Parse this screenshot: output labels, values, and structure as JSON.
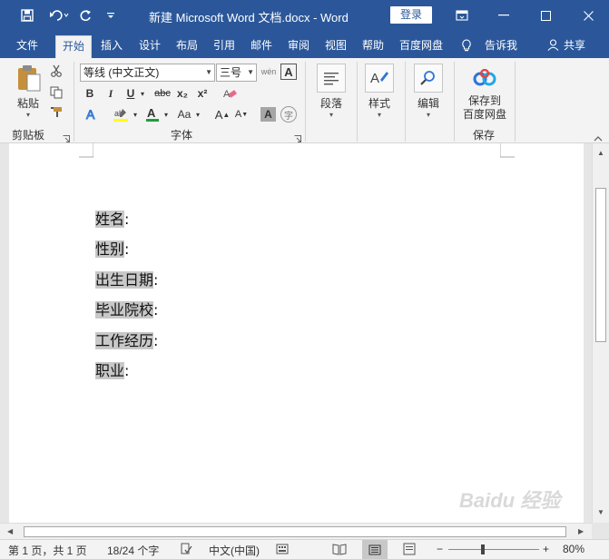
{
  "window": {
    "title": "新建 Microsoft Word 文档.docx  -  Word",
    "login_label": "登录"
  },
  "tabs": [
    {
      "label": "文件"
    },
    {
      "label": "开始"
    },
    {
      "label": "插入"
    },
    {
      "label": "设计"
    },
    {
      "label": "布局"
    },
    {
      "label": "引用"
    },
    {
      "label": "邮件"
    },
    {
      "label": "审阅"
    },
    {
      "label": "视图"
    },
    {
      "label": "帮助"
    },
    {
      "label": "百度网盘"
    },
    {
      "label": "告诉我"
    },
    {
      "label": "共享"
    }
  ],
  "ribbon": {
    "clipboard": {
      "paste_label": "粘贴",
      "group_label": "剪贴板"
    },
    "font": {
      "font_name": "等线 (中文正文)",
      "font_size": "三号",
      "bold": "B",
      "italic": "I",
      "underline": "U",
      "strike": "abc",
      "subscript": "x₂",
      "superscript": "x²",
      "change_case": "Aa",
      "grow": "A",
      "shrink": "A",
      "group_label": "字体"
    },
    "paragraph": {
      "label": "段落"
    },
    "styles": {
      "label": "样式"
    },
    "editing": {
      "label": "编辑"
    },
    "save": {
      "label_line1": "保存到",
      "label_line2": "百度网盘",
      "group_label": "保存"
    }
  },
  "document": {
    "lines": [
      {
        "highlight": "姓名",
        "rest": ":"
      },
      {
        "highlight": "性别",
        "rest": ":"
      },
      {
        "highlight": "出生日期",
        "rest": ":"
      },
      {
        "highlight": "毕业院校",
        "rest": ":"
      },
      {
        "highlight": "工作经历",
        "rest": ":"
      },
      {
        "highlight": "职业",
        "rest": ":"
      }
    ]
  },
  "status": {
    "page": "第 1 页，共 1 页",
    "words": "18/24 个字",
    "language": "中文(中国)",
    "zoom": "80%",
    "zoom_minus": "−",
    "zoom_plus": "+"
  },
  "watermark": "Baidu 经验",
  "colors": {
    "accent": "#2b579a",
    "highlight": "#c8c8c8"
  }
}
